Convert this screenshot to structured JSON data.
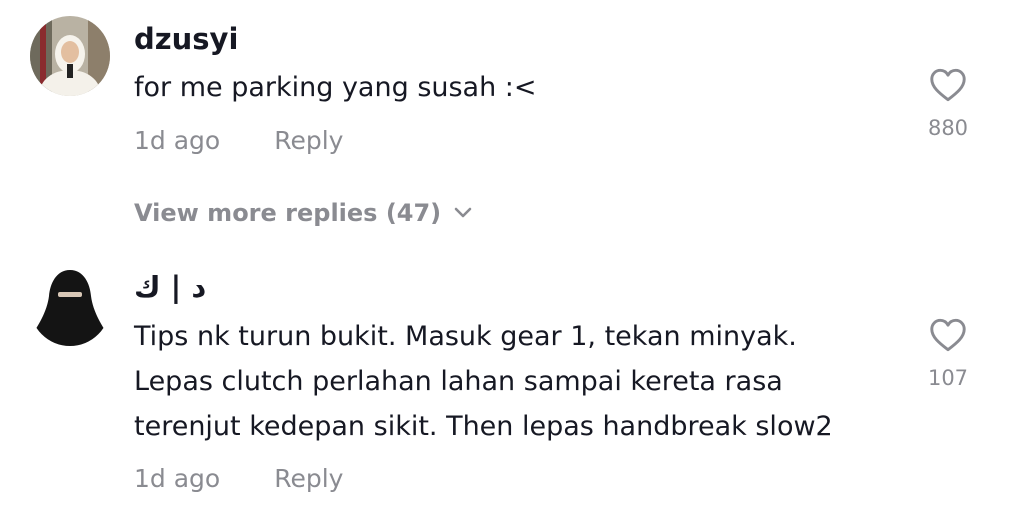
{
  "comments": [
    {
      "username": "dzusyi",
      "text_lines": [
        "for me parking yang susah :<"
      ],
      "time": "1d ago",
      "reply_label": "Reply",
      "like_count": "880",
      "avatar_icon": "user-avatar-photo"
    },
    {
      "username": "د | ك",
      "text_lines": [
        "Tips nk turun bukit. Masuk gear 1, tekan minyak.",
        "Lepas clutch perlahan lahan sampai kereta rasa",
        "terenjut kedepan sikit. Then lepas handbreak slow2"
      ],
      "time": "1d ago",
      "reply_label": "Reply",
      "like_count": "107",
      "avatar_icon": "user-avatar-photo"
    }
  ],
  "view_more_replies": "View more replies (47)",
  "colors": {
    "primary_text": "#161823",
    "secondary_text": "#8a8b91",
    "background": "#ffffff"
  },
  "icons": {
    "like": "heart-outline-icon",
    "expand": "chevron-down-icon"
  }
}
